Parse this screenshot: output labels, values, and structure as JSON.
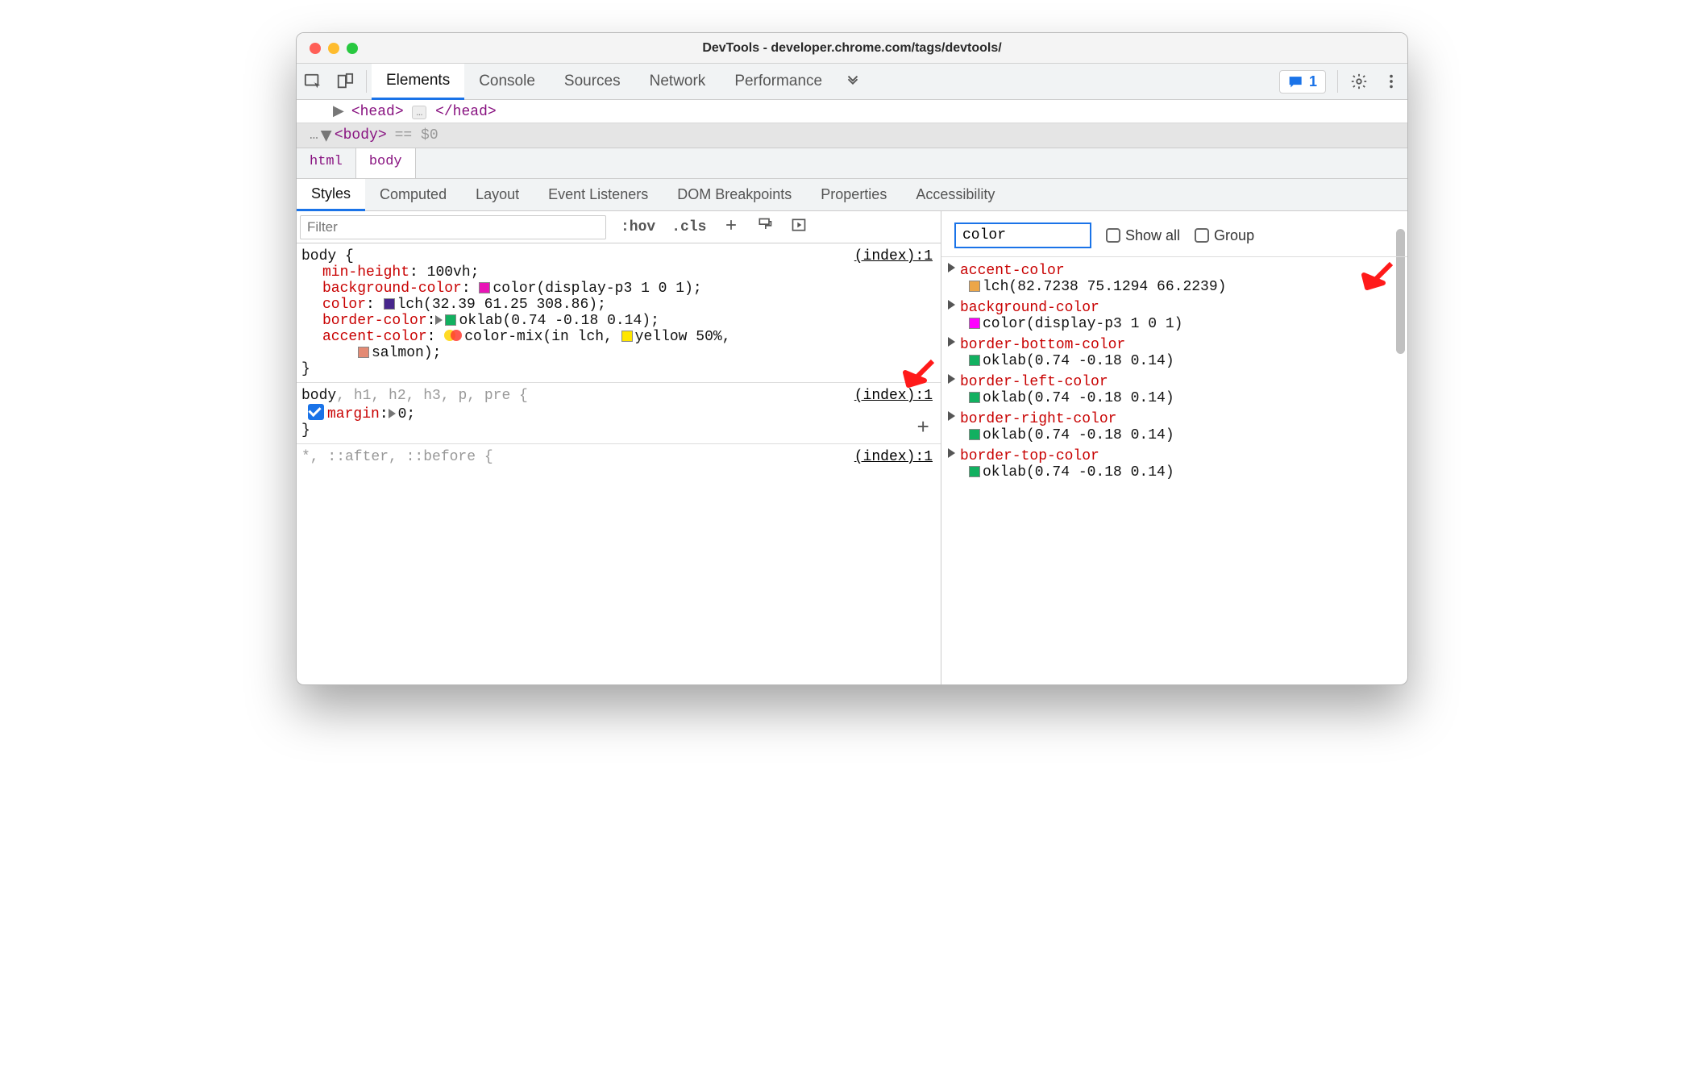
{
  "window": {
    "title": "DevTools - developer.chrome.com/tags/devtools/"
  },
  "mainTabs": {
    "elements": "Elements",
    "console": "Console",
    "sources": "Sources",
    "network": "Network",
    "performance": "Performance"
  },
  "issue_count": "1",
  "dom": {
    "headOpen": "<head>",
    "headClose": "</head>",
    "bodyOpen": "<body>",
    "eq": "== $0",
    "ellipsis": "…",
    "dots": "…"
  },
  "breadcrumb": {
    "html": "html",
    "body": "body"
  },
  "subTabs": {
    "styles": "Styles",
    "computed": "Computed",
    "layout": "Layout",
    "events": "Event Listeners",
    "dom": "DOM Breakpoints",
    "props": "Properties",
    "a11y": "Accessibility"
  },
  "stylesBar": {
    "filter_placeholder": "Filter",
    "hov": ":hov",
    "cls": ".cls"
  },
  "rules": {
    "r1": {
      "selector": "body {",
      "src": "(index):1",
      "close": "}",
      "minh_p": "min-height",
      "minh_v": "100vh;",
      "bg_p": "background-color",
      "bg_v": "color(display-p3 1 0 1);",
      "col_p": "color",
      "col_v": "lch(32.39 61.25 308.86);",
      "bord_p": "border-color",
      "bord_v": "oklab(0.74 -0.18 0.14);",
      "acc_p": "accent-color",
      "acc_v1": "color-mix(in lch, ",
      "acc_v2": "yellow 50%,",
      "acc_v3": "salmon);"
    },
    "r2": {
      "selector_main": "body",
      "selector_dim": ", h1, h2, h3, p, pre {",
      "src": "(index):1",
      "margin_p": "margin",
      "margin_v": "0;",
      "close": "}"
    },
    "r3": {
      "selector_dim": "*, ::after, ::before {",
      "src": "(index):1"
    }
  },
  "colors": {
    "bg_swatch": "#e815b6",
    "col_swatch": "#47268c",
    "border_swatch": "#12b060",
    "yellow_swatch": "#ffe600",
    "salmon_swatch": "#e38a74",
    "accent_swatch": "#eca648",
    "magenta_swatch": "#ff00ff"
  },
  "right": {
    "filter_value": "color",
    "showall": "Show all",
    "group": "Group",
    "items": [
      {
        "name": "accent-color",
        "val": "lch(82.7238 75.1294 66.2239)",
        "sw": "#eca648"
      },
      {
        "name": "background-color",
        "val": "color(display-p3 1 0 1)",
        "sw": "#ff00ff"
      },
      {
        "name": "border-bottom-color",
        "val": "oklab(0.74 -0.18 0.14)",
        "sw": "#12b060"
      },
      {
        "name": "border-left-color",
        "val": "oklab(0.74 -0.18 0.14)",
        "sw": "#12b060"
      },
      {
        "name": "border-right-color",
        "val": "oklab(0.74 -0.18 0.14)",
        "sw": "#12b060"
      },
      {
        "name": "border-top-color",
        "val": "oklab(0.74 -0.18 0.14)",
        "sw": "#12b060"
      }
    ]
  }
}
